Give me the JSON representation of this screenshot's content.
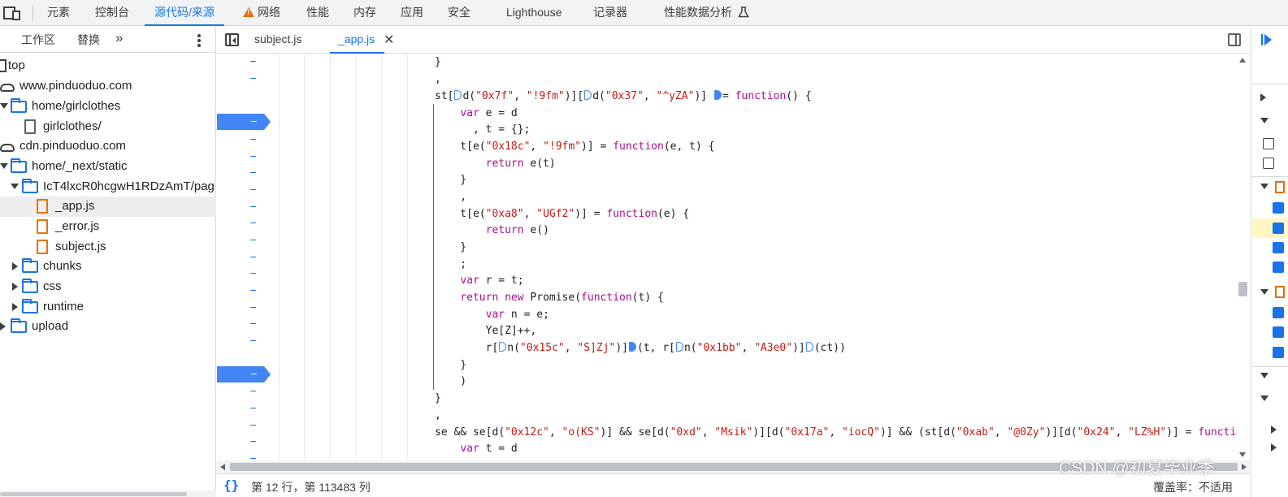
{
  "top_tabs": [
    "元素",
    "控制台",
    "源代码/来源",
    "网络",
    "性能",
    "内存",
    "应用",
    "安全",
    "Lighthouse",
    "记录器",
    "性能数据分析"
  ],
  "navigator": {
    "tabs": [
      "工作区",
      "替换"
    ],
    "more": "»",
    "tree": [
      {
        "label": "top",
        "icon": "frame-icon",
        "depth": 0
      },
      {
        "label": "www.pinduoduo.com",
        "icon": "cloud-icon",
        "depth": 0
      },
      {
        "label": "home/girlclothes",
        "icon": "folder-icon",
        "depth": 1,
        "expanded": true
      },
      {
        "label": "girlclothes/",
        "icon": "file-icon",
        "depth": 2
      },
      {
        "label": "cdn.pinduoduo.com",
        "icon": "cloud-icon",
        "depth": 0
      },
      {
        "label": "home/_next/static",
        "icon": "folder-icon",
        "depth": 1,
        "expanded": true
      },
      {
        "label": "IcT4lxcR0hcgwH1RDzAmT/pag",
        "icon": "folder-icon",
        "depth": 2,
        "expanded": true
      },
      {
        "label": "_app.js",
        "icon": "js-file-icon",
        "depth": 3,
        "selected": true
      },
      {
        "label": "_error.js",
        "icon": "js-file-icon",
        "depth": 3
      },
      {
        "label": "subject.js",
        "icon": "js-file-icon",
        "depth": 3
      },
      {
        "label": "chunks",
        "icon": "folder-icon",
        "depth": 2,
        "expanded": false
      },
      {
        "label": "css",
        "icon": "folder-icon",
        "depth": 2,
        "expanded": false
      },
      {
        "label": "runtime",
        "icon": "folder-icon",
        "depth": 2,
        "expanded": false
      },
      {
        "label": "upload",
        "icon": "folder-icon",
        "depth": 1,
        "expanded": false
      }
    ]
  },
  "editor": {
    "tabs": [
      {
        "label": "subject.js",
        "active": false
      },
      {
        "label": "_app.js",
        "active": true,
        "closable": true
      }
    ],
    "close_glyph": "✕",
    "status_braces": "{}",
    "status_position": "第 12 行，第 113483 列",
    "coverage": "覆盖率：不适用"
  },
  "watermark": "CSDN @初夏毕业季",
  "colors": {
    "accent": "#1a73e8",
    "breakpoint": "#4285f4",
    "keyword": "#aa0d91",
    "string": "#c41a16"
  }
}
